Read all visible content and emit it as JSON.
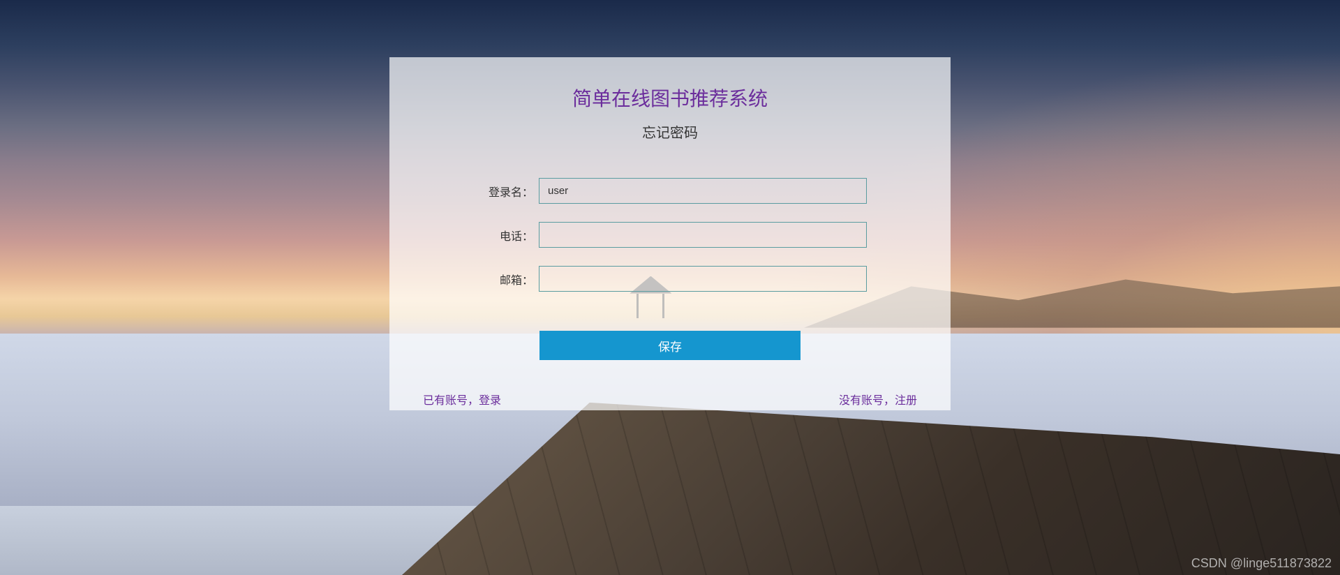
{
  "title": "简单在线图书推荐系统",
  "subtitle": "忘记密码",
  "form": {
    "username_label": "登录名：",
    "username_value": "user",
    "phone_label": "电话：",
    "phone_value": "",
    "email_label": "邮箱：",
    "email_value": ""
  },
  "save_button": "保存",
  "links": {
    "login": "已有账号，登录",
    "register": "没有账号，注册"
  },
  "watermark": "CSDN @linge511873822"
}
